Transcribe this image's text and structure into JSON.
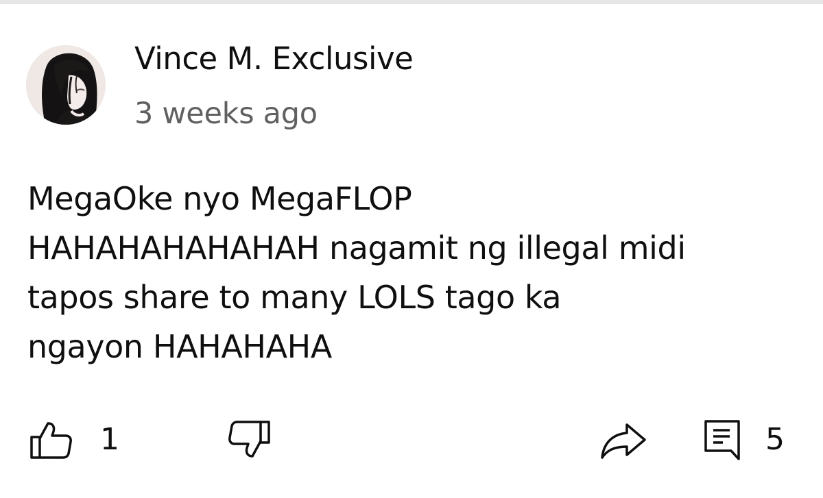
{
  "comment": {
    "author": "Vince M. Exclusive",
    "timestamp": "3 weeks ago",
    "text_lines": [
      "MegaOke nyo MegaFLOP",
      "HAHAHAHAHAHAH nagamit ng illegal midi",
      "tapos share to many LOLS tago ka",
      "ngayon HAHAHAHA"
    ],
    "avatar_icon": "user-avatar"
  },
  "actions": {
    "like_count": "1",
    "reply_count": "5",
    "icons": {
      "like": "thumbs-up-icon",
      "dislike": "thumbs-down-icon",
      "share": "share-arrow-icon",
      "reply": "comment-icon"
    }
  },
  "colors": {
    "text_primary": "#0f0f0f",
    "text_secondary": "#606060",
    "divider": "#e6e6e6"
  }
}
